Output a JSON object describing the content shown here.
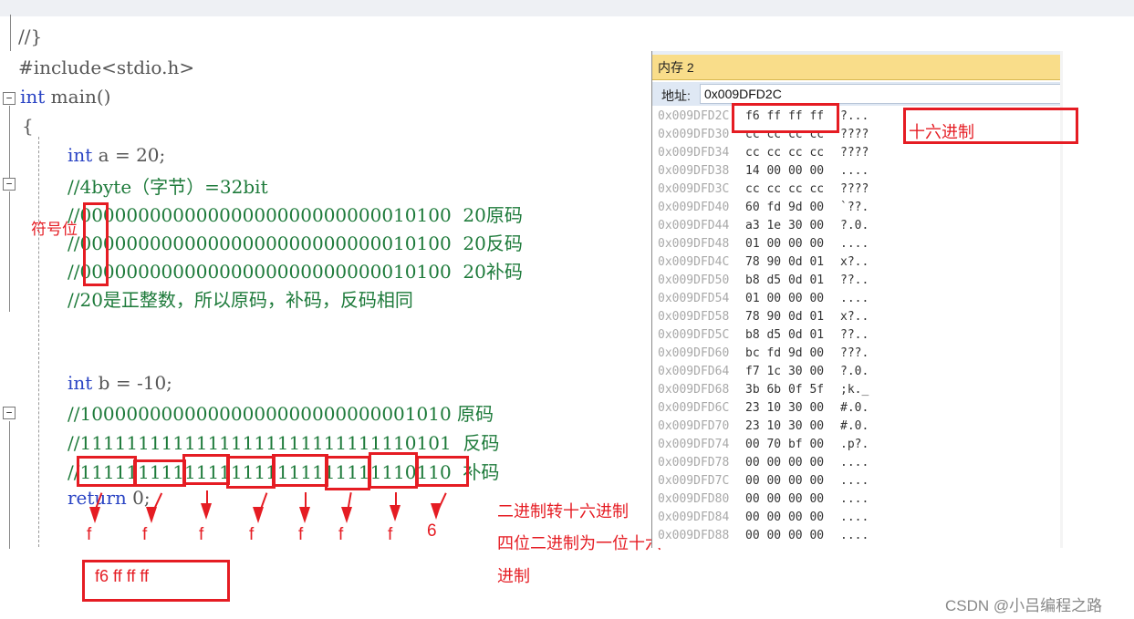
{
  "code": {
    "line_prev_comment": "//}",
    "include": "#include<stdio.h>",
    "main_kw": "int",
    "main_name": " main()",
    "brace_open": "{",
    "decl_a_kw": "int",
    "decl_a_rest": " a = 20;",
    "comment_byte": "//4byte（字节）=32bit",
    "bin_a_orig": "//00000000000000000000000000010100  20原码",
    "bin_a_inv": "//00000000000000000000000000010100  20反码",
    "bin_a_comp": "//00000000000000000000000000010100  20补码",
    "comment_pos": "//20是正整数，所以原码，补码，反码相同",
    "decl_b_kw": "int",
    "decl_b_rest": " b = -10;",
    "bin_b_orig": "//10000000000000000000000000001010 原码",
    "bin_b_inv": "//11111111111111111111111111110101  反码",
    "bin_b_comp": "//11111111111111111111111111110110  补码",
    "return_kw": "return",
    "return_rest": " 0;"
  },
  "annotations": {
    "sign_bit": "符号位",
    "hex_label": "十六进制",
    "bin_to_hex": "二进制转十六进制",
    "four_bits_line1": "四位二进制为一位十六",
    "four_bits_line2": "进制",
    "nibbles": [
      "f",
      "f",
      "f",
      "f",
      "f",
      "f",
      "f",
      "6"
    ],
    "result": "f6 ff  ff  ff"
  },
  "memory": {
    "title": "内存 2",
    "address_label": "地址:",
    "address_value": "0x009DFD2C",
    "rows": [
      {
        "addr": "0x009DFD2C",
        "bytes": "f6 ff ff ff",
        "ascii": "?..."
      },
      {
        "addr": "0x009DFD30",
        "bytes": "cc cc cc cc",
        "ascii": "????"
      },
      {
        "addr": "0x009DFD34",
        "bytes": "cc cc cc cc",
        "ascii": "????"
      },
      {
        "addr": "0x009DFD38",
        "bytes": "14 00 00 00",
        "ascii": "...."
      },
      {
        "addr": "0x009DFD3C",
        "bytes": "cc cc cc cc",
        "ascii": "????"
      },
      {
        "addr": "0x009DFD40",
        "bytes": "60 fd 9d 00",
        "ascii": "`??."
      },
      {
        "addr": "0x009DFD44",
        "bytes": "a3 1e 30 00",
        "ascii": "?.0."
      },
      {
        "addr": "0x009DFD48",
        "bytes": "01 00 00 00",
        "ascii": "...."
      },
      {
        "addr": "0x009DFD4C",
        "bytes": "78 90 0d 01",
        "ascii": "x?.."
      },
      {
        "addr": "0x009DFD50",
        "bytes": "b8 d5 0d 01",
        "ascii": "??.."
      },
      {
        "addr": "0x009DFD54",
        "bytes": "01 00 00 00",
        "ascii": "...."
      },
      {
        "addr": "0x009DFD58",
        "bytes": "78 90 0d 01",
        "ascii": "x?.."
      },
      {
        "addr": "0x009DFD5C",
        "bytes": "b8 d5 0d 01",
        "ascii": "??.."
      },
      {
        "addr": "0x009DFD60",
        "bytes": "bc fd 9d 00",
        "ascii": "???."
      },
      {
        "addr": "0x009DFD64",
        "bytes": "f7 1c 30 00",
        "ascii": "?.0."
      },
      {
        "addr": "0x009DFD68",
        "bytes": "3b 6b 0f 5f",
        "ascii": ";k._"
      },
      {
        "addr": "0x009DFD6C",
        "bytes": "23 10 30 00",
        "ascii": "#.0."
      },
      {
        "addr": "0x009DFD70",
        "bytes": "23 10 30 00",
        "ascii": "#.0."
      },
      {
        "addr": "0x009DFD74",
        "bytes": "00 70 bf 00",
        "ascii": ".p?."
      },
      {
        "addr": "0x009DFD78",
        "bytes": "00 00 00 00",
        "ascii": "...."
      },
      {
        "addr": "0x009DFD7C",
        "bytes": "00 00 00 00",
        "ascii": "...."
      },
      {
        "addr": "0x009DFD80",
        "bytes": "00 00 00 00",
        "ascii": "...."
      },
      {
        "addr": "0x009DFD84",
        "bytes": "00 00 00 00",
        "ascii": "...."
      },
      {
        "addr": "0x009DFD88",
        "bytes": "00 00 00 00",
        "ascii": "...."
      }
    ]
  },
  "watermark": "CSDN @小吕编程之路",
  "colors": {
    "accent_red": "#e51c23",
    "comment_green": "#1d7a3a",
    "keyword_blue": "#2a44c4",
    "title_yellow": "#f9dd8a"
  }
}
